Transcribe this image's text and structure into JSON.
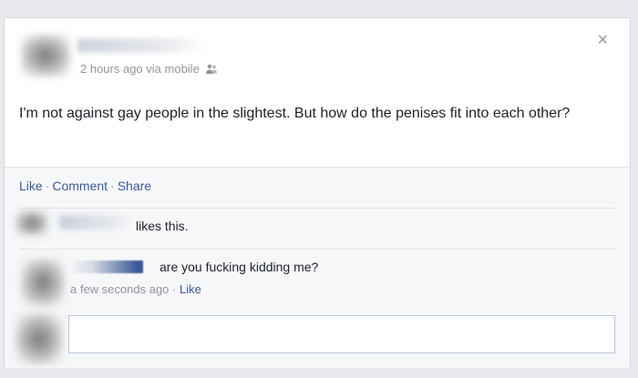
{
  "post": {
    "meta_time": "2 hours ago via mobile",
    "status_text": "I'm not against gay people in the slightest. But how do the penises fit into each other?",
    "close_glyph": "×"
  },
  "actions": {
    "like": "Like",
    "comment": "Comment",
    "share": "Share",
    "separator": "·"
  },
  "likes": {
    "text": "likes this."
  },
  "comment": {
    "text": "are you fucking kidding me?",
    "time": "a few seconds ago",
    "separator": "·",
    "like": "Like"
  },
  "colors": {
    "link": "#3b5998",
    "meta": "#90949c",
    "background": "#e9eaed"
  }
}
